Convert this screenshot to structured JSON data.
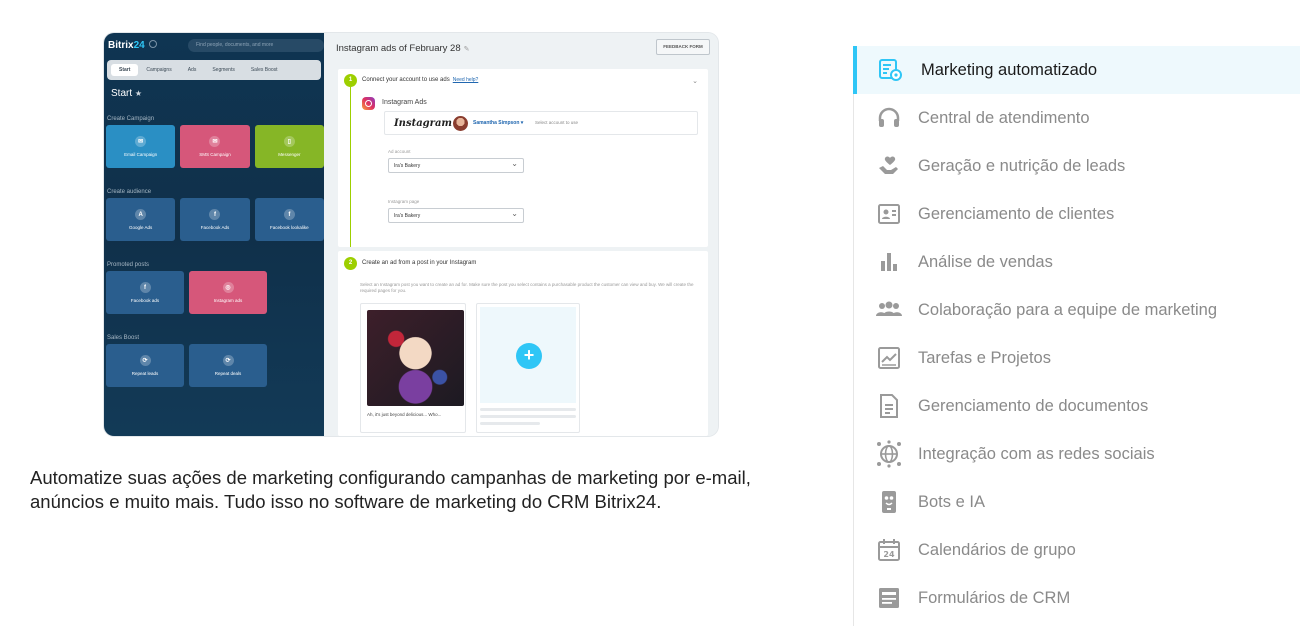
{
  "preview": {
    "logo_main": "Bitrix",
    "logo_num": "24",
    "search_placeholder": "Find people, documents, and more",
    "tabs": [
      "Start",
      "Campaigns",
      "Ads",
      "Segments",
      "Sales Boost"
    ],
    "start_label": "Start",
    "start_star": "★",
    "groups": [
      {
        "title": "Create Campaign",
        "tiles": [
          {
            "label": "Email Campaign",
            "icon": "✉",
            "color": "blue"
          },
          {
            "label": "SMS Campaign",
            "icon": "✉",
            "color": "pink"
          },
          {
            "label": "Messenger",
            "icon": "▯",
            "color": "green"
          }
        ]
      },
      {
        "title": "Create audience",
        "tiles": [
          {
            "label": "Google Ads",
            "icon": "A",
            "color": "navy"
          },
          {
            "label": "Facebook Ads",
            "icon": "f",
            "color": "navy"
          },
          {
            "label": "Facebook lookalike",
            "icon": "f",
            "color": "navy"
          }
        ]
      },
      {
        "title": "Promoted posts",
        "tiles": [
          {
            "label": "Facebook ads",
            "icon": "f",
            "color": "navy"
          },
          {
            "label": "Instagram ads",
            "icon": "◎",
            "color": "pink"
          }
        ]
      },
      {
        "title": "Sales Boost",
        "tiles": [
          {
            "label": "Repeat leads",
            "icon": "⟳",
            "color": "navy"
          },
          {
            "label": "Repeat deals",
            "icon": "⟳",
            "color": "navy"
          }
        ]
      }
    ],
    "panel_title": "Instagram ads of February 28",
    "edit_glyph": "✎",
    "feedback": "FEEDBACK FORM",
    "step1": {
      "num": "1",
      "title": "Connect your account to use ads",
      "help": "Need help?"
    },
    "ig_ads_label": "Instagram Ads",
    "ig_word": "Instagram",
    "account_name": "Samantha Simpson ▾",
    "account_select": "Select account to use",
    "ad_account_label": "Ad account",
    "ad_account_value": "Ira's Bakery",
    "ig_page_label": "Instagram page",
    "ig_page_value": "Ira's Bakery",
    "step2": {
      "num": "2",
      "title": "Create an ad from a post in your Instagram"
    },
    "step2_desc": "Select an Instagram post you want to create an ad for. Make sure the post you select contains a purchasable product the customer can view and buy. We will create the required pages for you.",
    "post_caption": "Ah, it's just beyond delicious... Who...",
    "add_glyph": "+"
  },
  "caption": "Automatize suas ações de marketing configurando campanhas de marketing por e-mail, anúncios e muito mais. Tudo isso no software de marketing do CRM Bitrix24.",
  "menu": {
    "accent": "#2fc6f6",
    "items": [
      {
        "label": "Marketing automatizado",
        "icon": "marketing-gear-icon",
        "active": true
      },
      {
        "label": "Central de atendimento",
        "icon": "headset-icon"
      },
      {
        "label": "Geração e nutrição de leads",
        "icon": "hand-heart-icon"
      },
      {
        "label": "Gerenciamento de clientes",
        "icon": "contact-card-icon"
      },
      {
        "label": "Análise de vendas",
        "icon": "bar-chart-icon"
      },
      {
        "label": "Colaboração para a equipe de marketing",
        "icon": "team-icon"
      },
      {
        "label": "Tarefas e Projetos",
        "icon": "task-chart-icon"
      },
      {
        "label": "Gerenciamento de documentos",
        "icon": "document-icon"
      },
      {
        "label": "Integração com as redes sociais",
        "icon": "globe-network-icon"
      },
      {
        "label": "Bots e IA",
        "icon": "robot-icon"
      },
      {
        "label": "Calendários de grupo",
        "icon": "calendar-icon"
      },
      {
        "label": "Formulários de CRM",
        "icon": "form-icon"
      }
    ]
  }
}
